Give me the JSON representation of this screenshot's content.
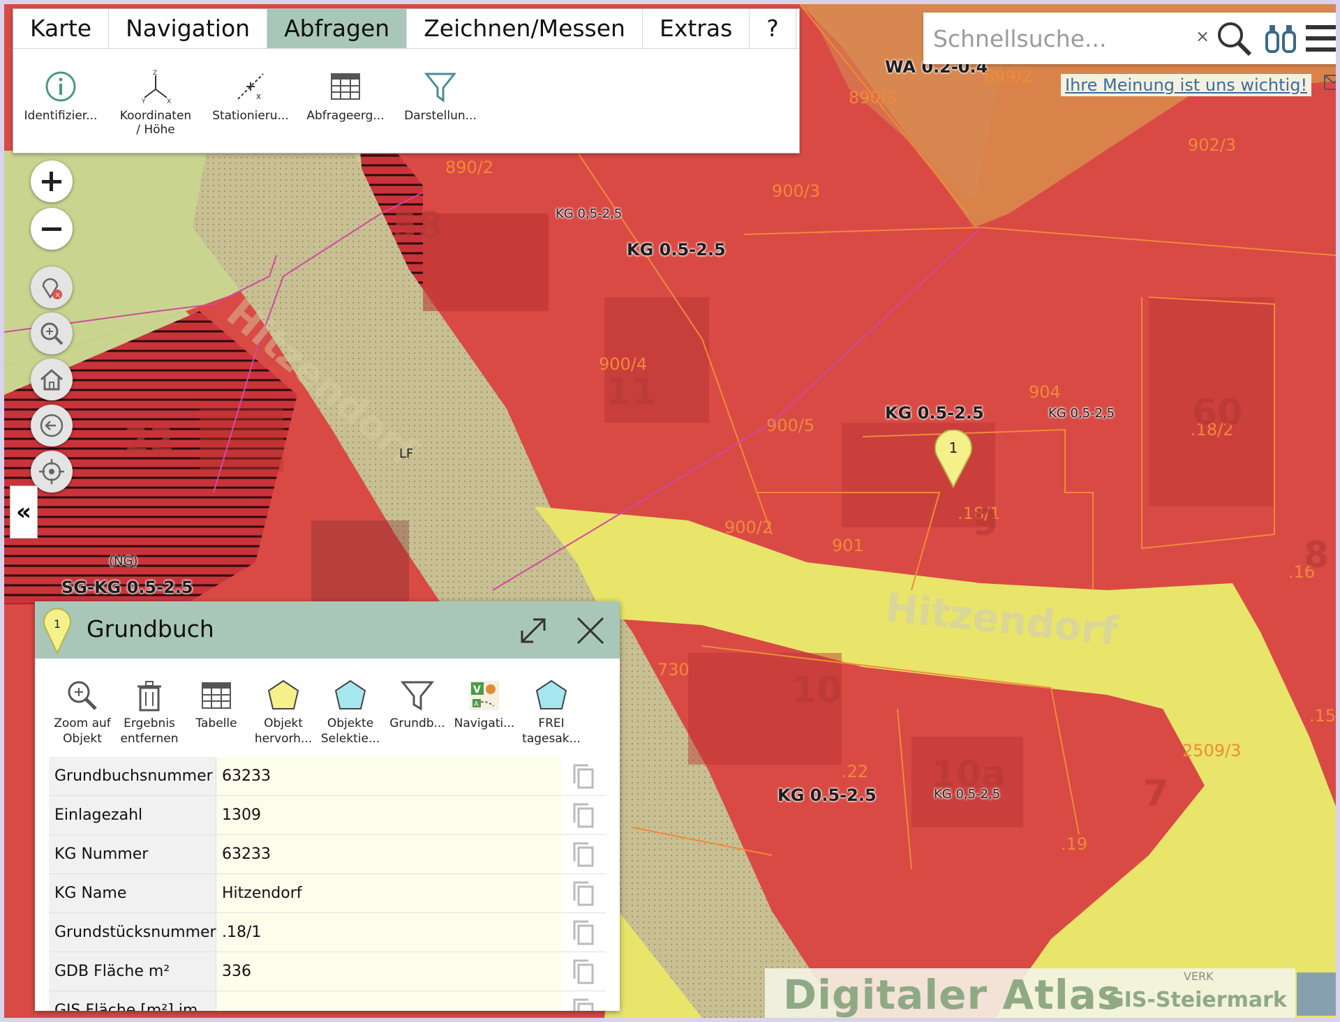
{
  "ribbon": {
    "tabs": [
      {
        "label": "Karte",
        "active": false
      },
      {
        "label": "Navigation",
        "active": false
      },
      {
        "label": "Abfragen",
        "active": true
      },
      {
        "label": "Zeichnen/Messen",
        "active": false
      },
      {
        "label": "Extras",
        "active": false
      },
      {
        "label": "?",
        "active": false
      }
    ],
    "tools": [
      {
        "label1": "Identifizier...",
        "label2": "",
        "icon": "info-circle-icon"
      },
      {
        "label1": "Koordinaten",
        "label2": "/ Höhe",
        "icon": "xyz-axes-icon"
      },
      {
        "label1": "Stationieru...",
        "label2": "",
        "icon": "stationing-icon"
      },
      {
        "label1": "Abfrageerg...",
        "label2": "",
        "icon": "table-icon"
      },
      {
        "label1": "Darstellun...",
        "label2": "",
        "icon": "filter-funnel-icon"
      }
    ]
  },
  "search": {
    "placeholder": "Schnellsuche..."
  },
  "feedback_link": "Ihre Meinung ist uns wichtig!",
  "map": {
    "zone_labels": [
      "KG 0,5-2,5",
      "KG 0.5-2.5",
      "KG 0.5-2.5",
      "KG 0,5-2,5",
      "KG 0.5-2.5",
      "KG 0,5-2,5",
      "SG-KG 0.5-2.5",
      "(NG)",
      "WA 0.2-0.4"
    ],
    "parcel_labels": [
      "890/2",
      "900/3",
      "890/3",
      "899/2",
      "902/3",
      "900/4",
      "900/5",
      "900/2",
      "901",
      "904",
      ".18/1",
      ".18/2",
      "730",
      "2509/3",
      ".19",
      ".22",
      ".16",
      ".15"
    ],
    "house_numbers": [
      "58",
      "11",
      "22",
      "9",
      "60",
      "10",
      "10a",
      "7",
      "8"
    ],
    "street_label": "Hitzendorf",
    "marker_number": "1",
    "lf_label": "LF",
    "colors": {
      "residential": "#d94a45",
      "dark_residential": "#b8322f",
      "road_yellow": "#e8e56a",
      "beige": "#c4bd8e",
      "green": "#c9d48f",
      "orange": "#d9834b",
      "parcel_line": "#f08a3a",
      "cadastre_line": "#d04aa0"
    }
  },
  "panel": {
    "title": "Grundbuch",
    "tools": [
      {
        "label1": "Zoom auf",
        "label2": "Objekt",
        "icon": "zoom-to-object-icon"
      },
      {
        "label1": "Ergebnis",
        "label2": "entfernen",
        "icon": "trash-icon"
      },
      {
        "label1": "Tabelle",
        "label2": "",
        "icon": "table-icon"
      },
      {
        "label1": "Objekt",
        "label2": "hervorh...",
        "icon": "highlight-polygon-icon"
      },
      {
        "label1": "Objekte",
        "label2": "Selektie...",
        "icon": "select-polygon-icon"
      },
      {
        "label1": "Grundb...",
        "label2": "",
        "icon": "filter-funnel-icon"
      },
      {
        "label1": "Navigati...",
        "label2": "",
        "icon": "navigation-route-icon"
      },
      {
        "label1": "FREI",
        "label2": "tagesak...",
        "icon": "free-polygon-icon"
      }
    ],
    "rows": [
      {
        "key": "Grundbuchsnummer",
        "value": "63233"
      },
      {
        "key": "Einlagezahl",
        "value": "1309"
      },
      {
        "key": "KG Nummer",
        "value": "63233"
      },
      {
        "key": "KG Name",
        "value": "Hitzendorf"
      },
      {
        "key": "Grundstücksnummer",
        "value": ".18/1"
      },
      {
        "key": "GDB Fläche m²",
        "value": "336"
      },
      {
        "key": "GIS Fläche [m²] im",
        "value": ""
      }
    ]
  },
  "atlas": {
    "title": "Digitaler Atlas",
    "subtitle": "GIS-Steiermark",
    "corner_text": "VERK"
  },
  "left_controls": [
    "zoom-in-icon",
    "zoom-out-icon",
    "remove-marker-icon",
    "magnify-icon",
    "home-icon",
    "back-icon",
    "locate-icon"
  ],
  "collapse_glyph": "«"
}
